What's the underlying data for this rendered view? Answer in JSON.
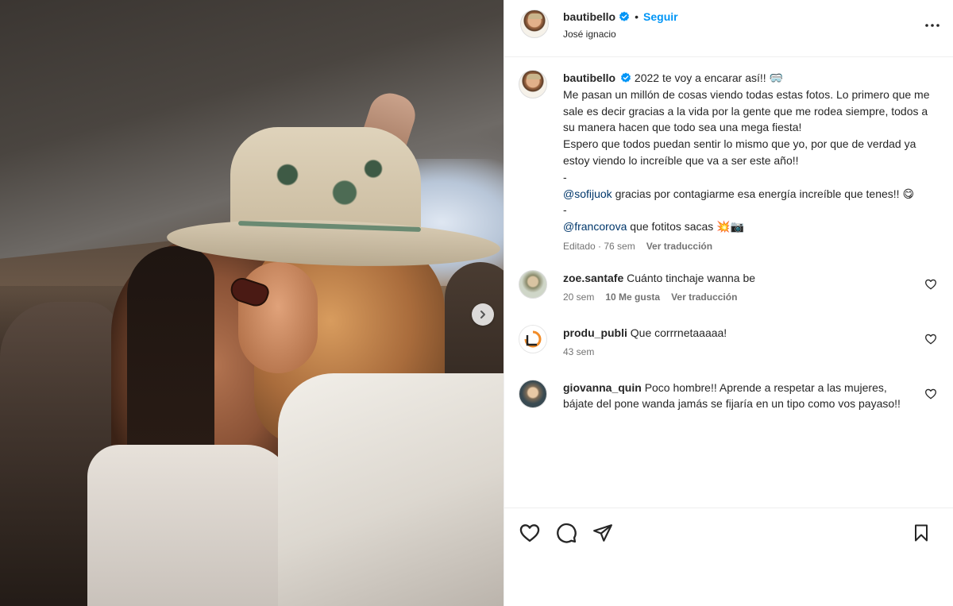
{
  "post": {
    "username": "bautibello",
    "follow_label": "Seguir",
    "separator": "•",
    "location": "José ignacio"
  },
  "caption": {
    "username": "bautibello",
    "line1": "2022 te voy a encarar así!! 🥽",
    "text_main": "Me pasan un millón de cosas viendo todas estas fotos. Lo primero que me sale es decir gracias a la vida por la gente que me rodea siempre, todos a su manera hacen que todo sea una mega fiesta!",
    "text_second": "Espero que todos puedan sentir lo mismo que yo, por que de verdad ya estoy viendo lo increíble que va a ser este año!!",
    "dash1": "-",
    "mention1": "@sofijuok",
    "mention1_text": " gracias por contagiarme esa energía increíble que tenes!! 😋",
    "dash2": "-",
    "mention2": "@francorova",
    "mention2_text": " que fotitos sacas 💥📷",
    "meta_edited": "Editado · 76 sem",
    "meta_translate": "Ver traducción"
  },
  "comments": [
    {
      "username": "zoe.santafe",
      "text": "Cuánto tinchaje wanna be",
      "time": "20 sem",
      "likes": "10 Me gusta",
      "translate": "Ver traducción"
    },
    {
      "username": "produ_publi",
      "text": "Que corrrnetaaaaa!",
      "time": "43 sem"
    },
    {
      "username": "giovanna_quin",
      "text": "Poco hombre!! Aprende a respetar a las mujeres, bájate del pone wanda jamás se fijaría en un tipo como vos payaso!!"
    }
  ],
  "icons": {
    "verified": "verified-badge-icon",
    "more": "more-options-icon",
    "next": "chevron-right-icon",
    "like": "heart-icon",
    "comment": "comment-icon",
    "share": "paper-plane-icon",
    "save": "bookmark-icon"
  },
  "colors": {
    "accent": "#0095f6",
    "verified": "#0095f6",
    "mention": "#00376b",
    "secondary_text": "#737373"
  }
}
